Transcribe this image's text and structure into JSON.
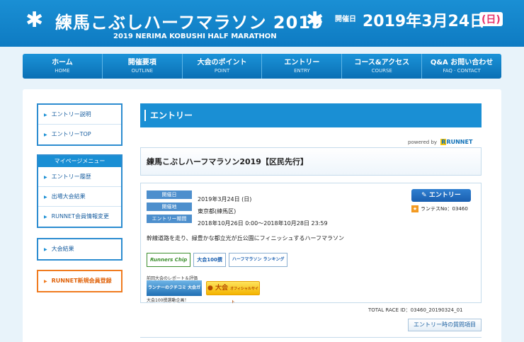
{
  "header": {
    "title": "練馬こぶしハーフマラソン 2019",
    "subtitle": "2019 NERIMA KOBUSHI HALF MARATHON",
    "date_label": "開催日",
    "date": "2019年3月24日",
    "date_day": "(日)",
    "brand_color": "#1a8fd4"
  },
  "nav": [
    {
      "jp": "ホーム",
      "en": "HOME"
    },
    {
      "jp": "開催要項",
      "en": "OUTLINE"
    },
    {
      "jp": "大会のポイント",
      "en": "POINT"
    },
    {
      "jp": "エントリー",
      "en": "ENTRY"
    },
    {
      "jp": "コース&アクセス",
      "en": "COURSE"
    },
    {
      "jp": "Q&A お問い合わせ",
      "en": "FAQ · CONTACT"
    }
  ],
  "sidebar": {
    "box1": [
      "エントリー説明",
      "エントリーTOP"
    ],
    "mypage_title": "マイページメニュー",
    "mypage": [
      "エントリー履歴",
      "出場大会結果",
      "RUNNET会員情報変更"
    ],
    "results": "大会結果",
    "register": "RUNNET新規会員登録"
  },
  "content": {
    "section_title": "エントリー",
    "powered_by": "powered by",
    "powered_logo": "RUNNET",
    "race_title": "練馬こぶしハーフマラソン2019【区民先行】",
    "info": [
      {
        "label": "開催日",
        "value": "2019年3月24日 (日)"
      },
      {
        "label": "開催地",
        "value": "東京都(練馬区)"
      },
      {
        "label": "エントリー期間",
        "value": "2018年10月26日 0:00〜2018年10月28日 23:59"
      }
    ],
    "entry_button": "エントリー",
    "runtes": "ランテスNo：03460",
    "description": "幹線道路を走り、緑豊かな都立光が丘公園にフィニッシュするハーフマラソン",
    "badges": [
      "Runners Chip",
      "大会100撰",
      "ハーフマラソン ランキング"
    ],
    "report_label": "前回大会のレポート＆評価",
    "report_banner": "ランナーのクチコミ 大会ガイド",
    "report_note": "大会100撰選動企画！",
    "official_main": "大会",
    "official_sub": "オフィシャルサイト",
    "total_race_id": "TOTAL RACE ID：03460_20190324_01",
    "qa_button": "エントリー時の質問項目"
  }
}
